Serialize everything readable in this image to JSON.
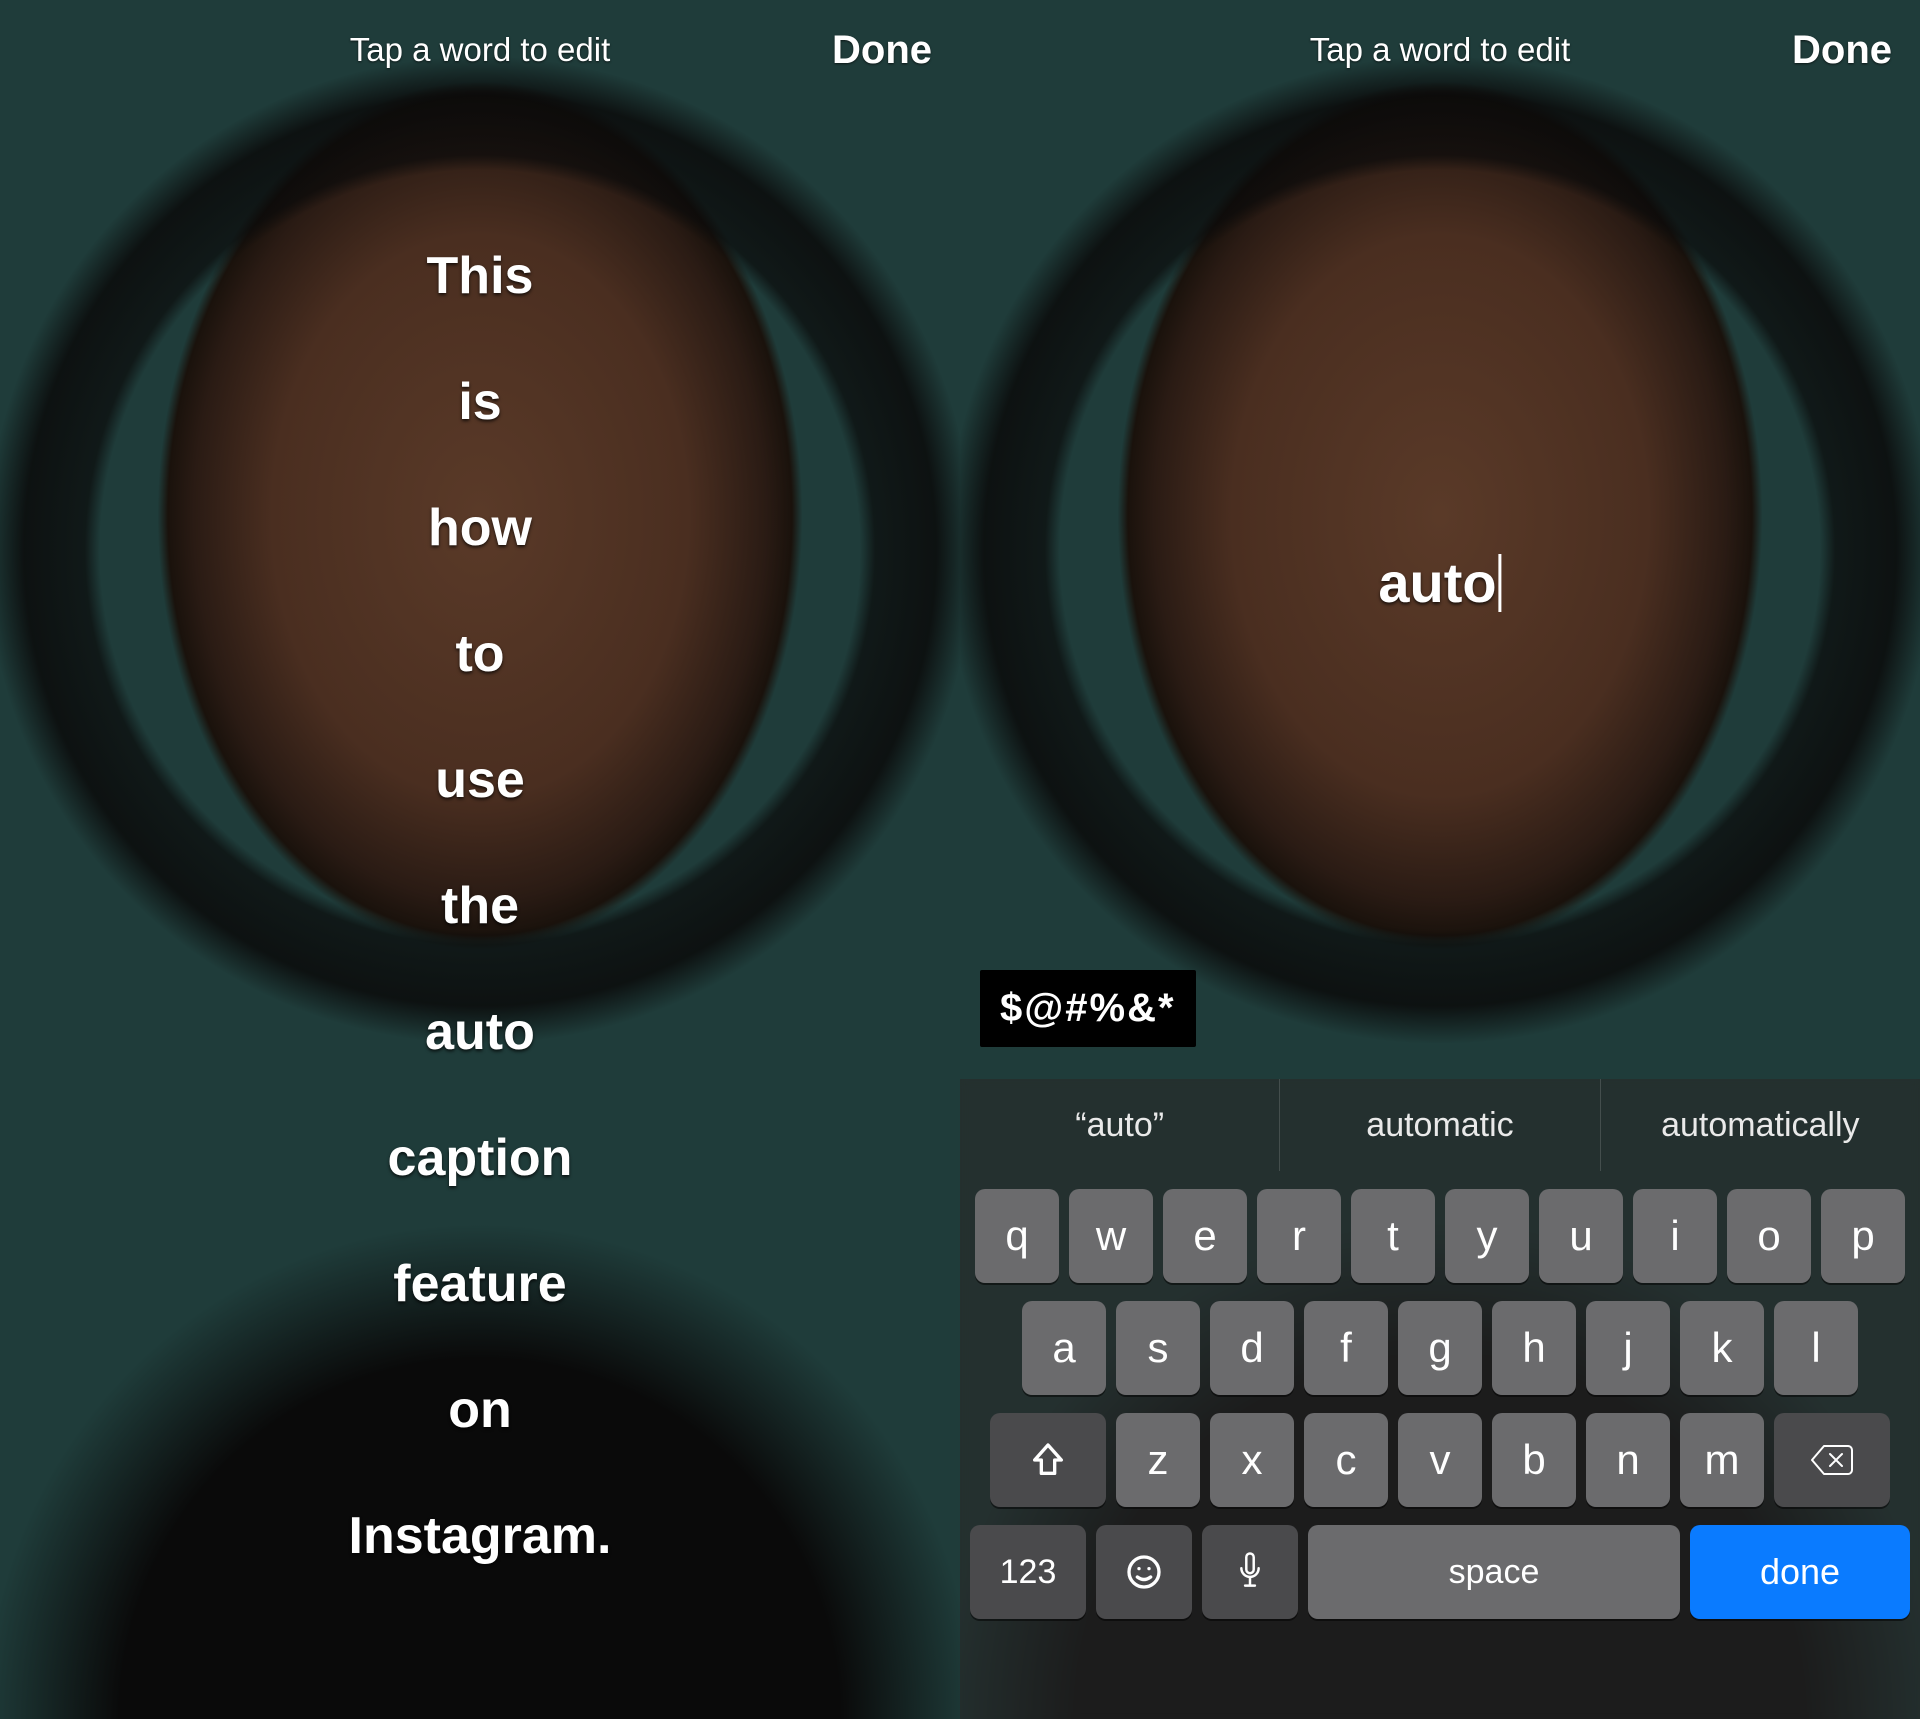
{
  "left": {
    "header": {
      "hint": "Tap a word to edit",
      "done": "Done"
    },
    "caption_words": [
      "This",
      "is",
      "how",
      "to",
      "use",
      "the",
      "auto",
      "caption",
      "feature",
      "on",
      "Instagram."
    ]
  },
  "right": {
    "header": {
      "hint": "Tap a word to edit",
      "done": "Done"
    },
    "edit_value": "auto",
    "censor_label": "$@#%&*",
    "keyboard": {
      "suggestions": [
        "“auto”",
        "automatic",
        "automatically"
      ],
      "row1": [
        "q",
        "w",
        "e",
        "r",
        "t",
        "y",
        "u",
        "i",
        "o",
        "p"
      ],
      "row2": [
        "a",
        "s",
        "d",
        "f",
        "g",
        "h",
        "j",
        "k",
        "l"
      ],
      "row3": [
        "z",
        "x",
        "c",
        "v",
        "b",
        "n",
        "m"
      ],
      "numbers_label": "123",
      "space_label": "space",
      "done_label": "done"
    }
  }
}
